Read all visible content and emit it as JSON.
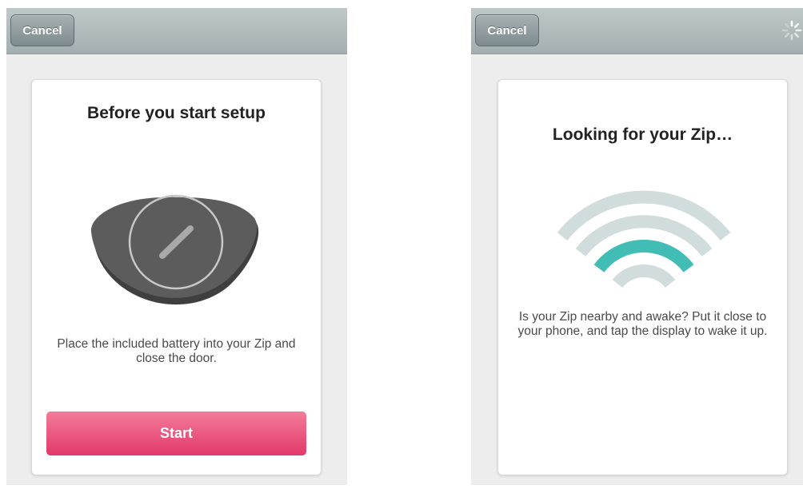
{
  "left_screen": {
    "nav": {
      "cancel_label": "Cancel"
    },
    "card": {
      "title": "Before you start setup",
      "description": "Place the included battery into your Zip and close the door.",
      "start_label": "Start"
    }
  },
  "right_screen": {
    "nav": {
      "cancel_label": "Cancel"
    },
    "card": {
      "title": "Looking for your Zip…",
      "description": "Is your Zip nearby and awake? Put it close to your phone, and tap the display to wake it up."
    }
  },
  "colors": {
    "accent_pink": "#e2386a",
    "signal_active": "#42bdb5",
    "signal_idle": "#d1dcdc",
    "device_body": "#5c5c5c"
  },
  "icons": [
    "zip-device-illustration",
    "wifi-signal-icon",
    "activity-spinner-icon"
  ]
}
